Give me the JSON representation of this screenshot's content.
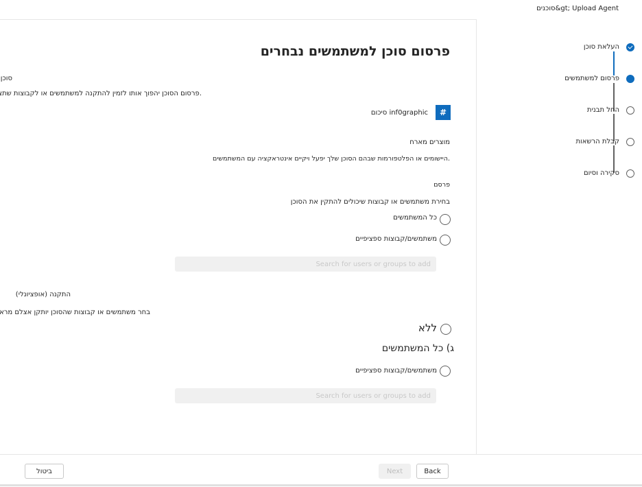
{
  "topbar": {
    "breadcrumb": "סוכנים&gt; Upload Agent"
  },
  "stepper": {
    "steps": [
      {
        "label": "העלאת סוכן",
        "state": "done"
      },
      {
        "label": "פרסום למשתמשים",
        "state": "active"
      },
      {
        "label": "החל תבנית",
        "state": "pending"
      },
      {
        "label": "קבלת הרשאות",
        "state": "pending"
      },
      {
        "label": "סקירה וסיום",
        "state": "pending"
      }
    ]
  },
  "main": {
    "title": "פרסום סוכן למשתמשים נבחרים",
    "agent_label": "סוכן",
    "agent_desc": "פרסום הסוכן יהפוך אותו לזמין להתקנה למשתמשים או לקבוצות שתציין.",
    "agent_summary": "סיכום inf0graphic",
    "hash_icon": "#",
    "products_label": "מוצרים מארח",
    "products_desc": "היישומים או הפלטפורמות שבהם הסוכן שלך יפעל ויקיים אינטראקציה עם המשתמשים.",
    "publish_label": "פרסם",
    "publish_desc": "בחירת משתמשים או קבוצות שיכולים להתקין את הסוכן",
    "publish_opt_all": "כל המשתמשים",
    "publish_opt_specific": "משתמשים/קבוצות ספציפיים",
    "search_placeholder": "Search for users or groups to add",
    "install_label": "(התקנה (אופציונלי",
    "install_desc": "בחר משתמשים או קבוצות שהסוכן יותקן אצלם מראש",
    "install_opt_none": "ללא",
    "install_opt_all": "ג) כל המשתמשים",
    "install_opt_specific": "משתמשים/קבוצות ספציפיים",
    "search_placeholder2": "Search for users or groups to add"
  },
  "footer": {
    "back": "Back",
    "next": "Next",
    "cancel": "ביטול"
  },
  "colors": {
    "accent": "#0f6cbd"
  }
}
